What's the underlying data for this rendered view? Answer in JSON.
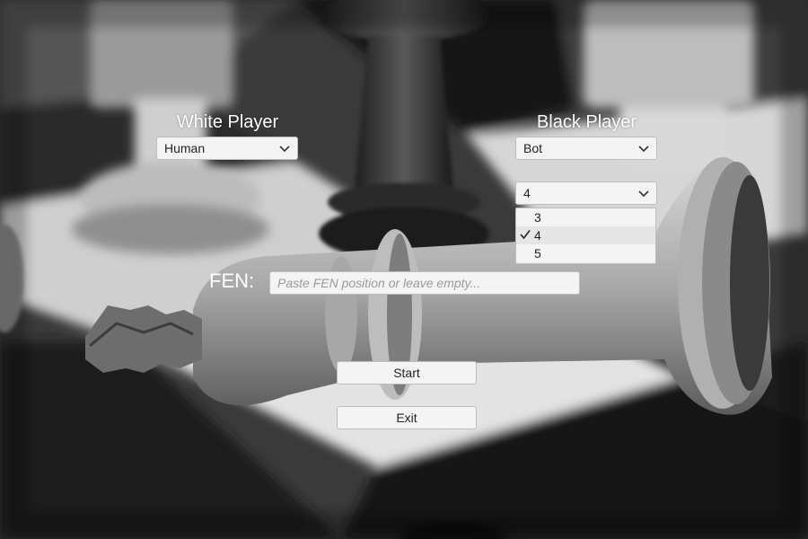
{
  "white": {
    "label": "White Player",
    "selected": "Human"
  },
  "black": {
    "label": "Black Player",
    "selected": "Bot"
  },
  "depth": {
    "selected": "4",
    "options": [
      "3",
      "4",
      "5"
    ],
    "checked_option": "4"
  },
  "fen": {
    "label": "FEN:",
    "placeholder": "Paste FEN position or leave empty..."
  },
  "buttons": {
    "start": "Start",
    "exit": "Exit"
  },
  "icons": {
    "dropdown": "chevron-down-icon",
    "selected_option": "checkmark-icon"
  }
}
